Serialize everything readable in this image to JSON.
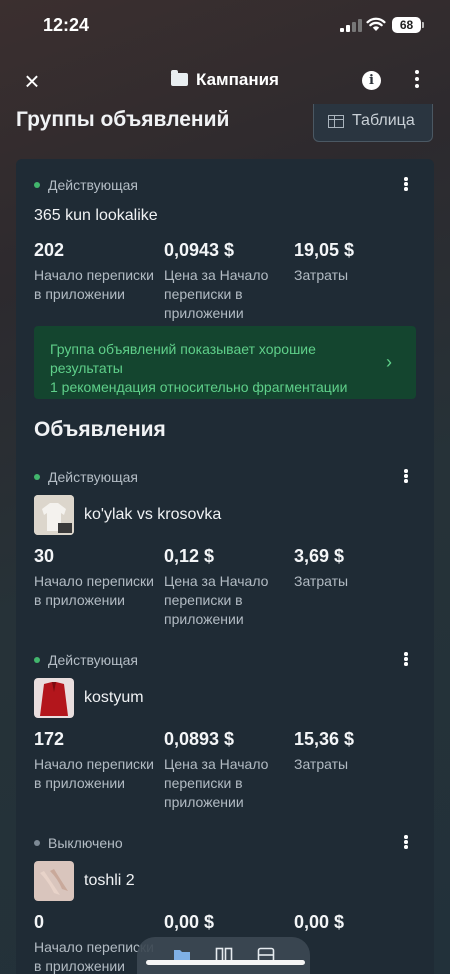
{
  "status_bar": {
    "time": "12:24",
    "battery": "68"
  },
  "header": {
    "title": "Кампания",
    "close_icon": "close-icon",
    "info_icon": "info-icon",
    "more_icon": "more-vertical-icon"
  },
  "section": {
    "title": "Группы объявлений",
    "table_button_label": "Таблица"
  },
  "ad_group": {
    "status": "Действующая",
    "status_color": "#42b66d",
    "name": "365 kun lookalike",
    "metrics": [
      {
        "value": "202",
        "label": "Начало переписки в приложении"
      },
      {
        "value": "0,0943 $",
        "label": "Цена за Начало переписки в приложении"
      },
      {
        "value": "19,05 $",
        "label": "Затраты"
      }
    ],
    "recommendation": {
      "line1": "Группа объявлений показывает хорошие результаты",
      "line2": "1 рекомендация относительно фрагментации"
    }
  },
  "ads_title": "Объявления",
  "ads": [
    {
      "status": "Действующая",
      "status_color": "#42b66d",
      "name": "ko'ylak vs krosovka",
      "metrics": [
        {
          "value": "30",
          "label": "Начало переписки в приложении"
        },
        {
          "value": "0,12 $",
          "label": "Цена за Начало переписки в приложении"
        },
        {
          "value": "3,69 $",
          "label": "Затраты"
        }
      ]
    },
    {
      "status": "Действующая",
      "status_color": "#42b66d",
      "name": "kostyum",
      "metrics": [
        {
          "value": "172",
          "label": "Начало переписки в приложении"
        },
        {
          "value": "0,0893 $",
          "label": "Цена за Начало переписки в приложении"
        },
        {
          "value": "15,36 $",
          "label": "Затраты"
        }
      ]
    },
    {
      "status": "Выключено",
      "status_color": "#7d8a96",
      "name": "toshli 2",
      "metrics": [
        {
          "value": "0",
          "label": "Начало переписки в приложении"
        },
        {
          "value": "0,00 $",
          "label": ""
        },
        {
          "value": "0,00 $",
          "label": ""
        }
      ]
    }
  ],
  "bottom_tabs": [
    "folder-icon",
    "columns-icon",
    "ad-preview-icon"
  ]
}
